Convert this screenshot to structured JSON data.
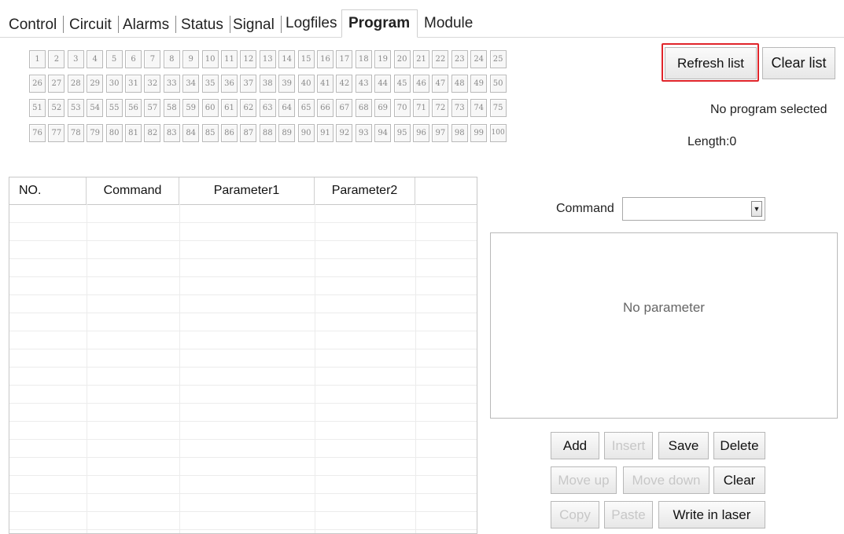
{
  "tabs": [
    {
      "label": "Control",
      "active": false
    },
    {
      "label": "Circuit",
      "active": false
    },
    {
      "label": "Alarms",
      "active": false
    },
    {
      "label": "Status",
      "active": false
    },
    {
      "label": "Signal",
      "active": false
    },
    {
      "label": "Logfiles",
      "active": false
    },
    {
      "label": "Program",
      "active": true
    },
    {
      "label": "Module",
      "active": false
    }
  ],
  "program_slots": [
    "1",
    "2",
    "3",
    "4",
    "5",
    "6",
    "7",
    "8",
    "9",
    "10",
    "11",
    "12",
    "13",
    "14",
    "15",
    "16",
    "17",
    "18",
    "19",
    "20",
    "21",
    "22",
    "23",
    "24",
    "25",
    "26",
    "27",
    "28",
    "29",
    "30",
    "31",
    "32",
    "33",
    "34",
    "35",
    "36",
    "37",
    "38",
    "39",
    "40",
    "41",
    "42",
    "43",
    "44",
    "45",
    "46",
    "47",
    "48",
    "49",
    "50",
    "51",
    "52",
    "53",
    "54",
    "55",
    "56",
    "57",
    "58",
    "59",
    "60",
    "61",
    "62",
    "63",
    "64",
    "65",
    "66",
    "67",
    "68",
    "69",
    "70",
    "71",
    "72",
    "73",
    "74",
    "75",
    "76",
    "77",
    "78",
    "79",
    "80",
    "81",
    "82",
    "83",
    "84",
    "85",
    "86",
    "87",
    "88",
    "89",
    "90",
    "91",
    "92",
    "93",
    "94",
    "95",
    "96",
    "97",
    "98",
    "99",
    "100"
  ],
  "toolbar": {
    "refresh_label": "Refresh list",
    "clear_list_label": "Clear list"
  },
  "status": {
    "selected_program": "No program selected",
    "length": "Length:0"
  },
  "table": {
    "headers": [
      "NO.",
      "Command",
      "Parameter1",
      "Parameter2",
      ""
    ],
    "rows": []
  },
  "command": {
    "label": "Command",
    "selected_value": ""
  },
  "parameters": {
    "empty_text": "No parameter"
  },
  "actions": [
    {
      "label": "Add",
      "enabled": true
    },
    {
      "label": "Insert",
      "enabled": false
    },
    {
      "label": "Save",
      "enabled": true
    },
    {
      "label": "Delete",
      "enabled": true
    },
    {
      "label": "Move up",
      "enabled": false
    },
    {
      "label": "Move down",
      "enabled": false
    },
    {
      "label": "Clear",
      "enabled": true
    },
    {
      "label": "Copy",
      "enabled": false
    },
    {
      "label": "Paste",
      "enabled": false
    },
    {
      "label": "Write in laser",
      "enabled": true
    }
  ],
  "colors": {
    "highlight": "#e0242a",
    "disabled_text": "#c7c7c7",
    "grid_button_text": "#8a8a8a"
  }
}
